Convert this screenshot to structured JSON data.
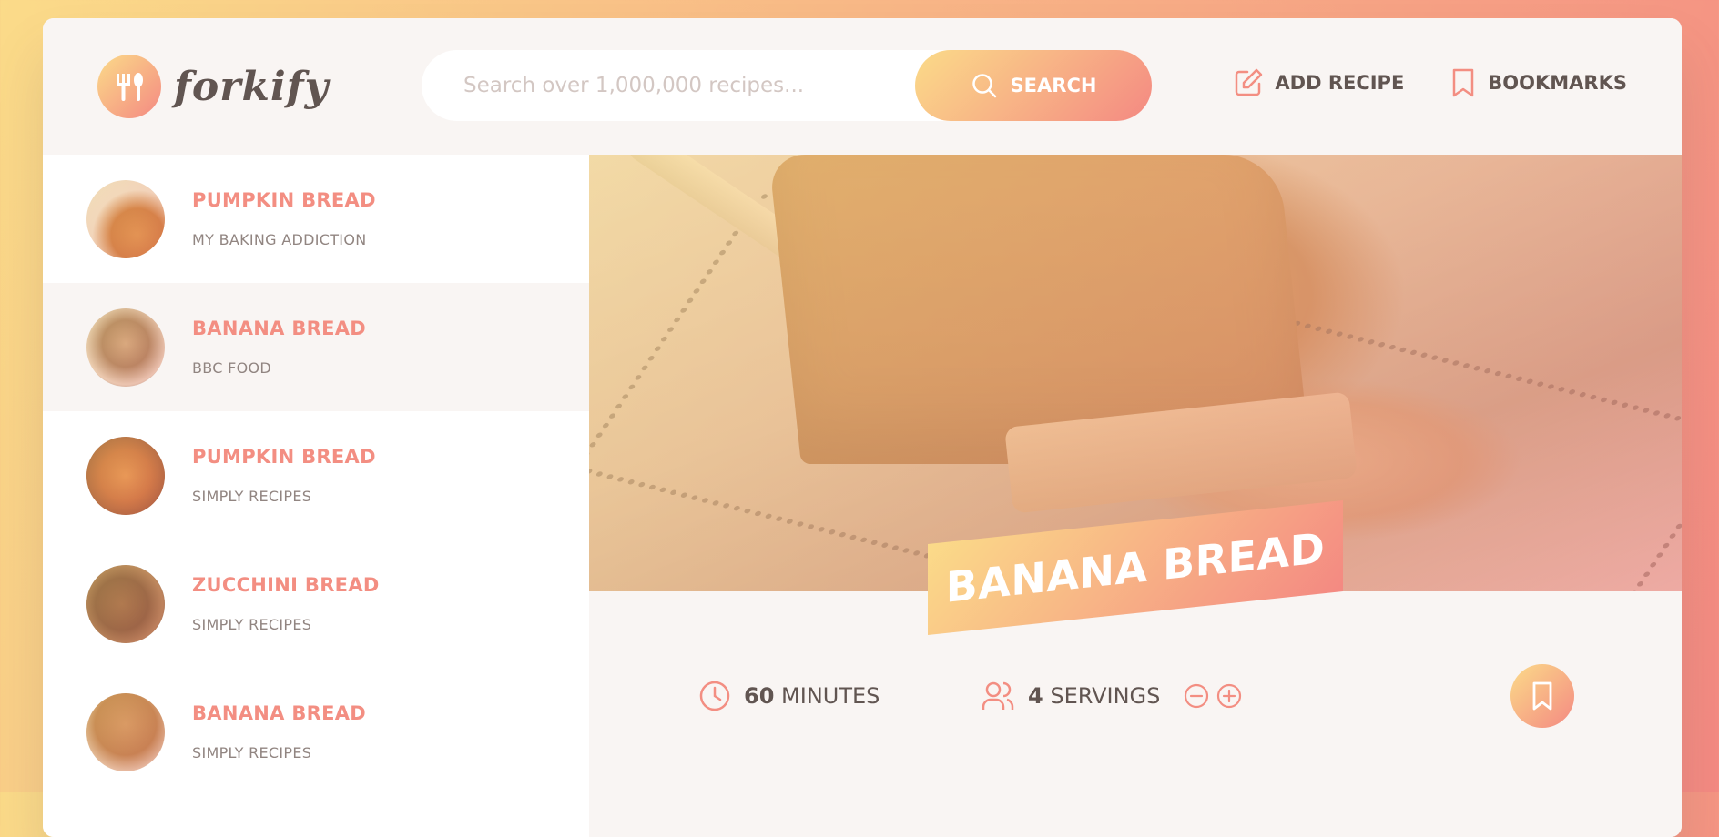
{
  "brand": {
    "name": "forkify"
  },
  "search": {
    "placeholder": "Search over 1,000,000 recipes...",
    "button_label": "SEARCH"
  },
  "nav": {
    "add_recipe": "ADD RECIPE",
    "bookmarks": "BOOKMARKS"
  },
  "results": [
    {
      "title": "PUMPKIN BREAD",
      "publisher": "MY BAKING ADDICTION",
      "active": false
    },
    {
      "title": "BANANA BREAD",
      "publisher": "BBC FOOD",
      "active": true
    },
    {
      "title": "PUMPKIN BREAD",
      "publisher": "SIMPLY RECIPES",
      "active": false
    },
    {
      "title": "ZUCCHINI BREAD",
      "publisher": "SIMPLY RECIPES",
      "active": false
    },
    {
      "title": "BANANA BREAD",
      "publisher": "SIMPLY RECIPES",
      "active": false
    }
  ],
  "recipe": {
    "title": "BANANA BREAD",
    "minutes": "60",
    "minutes_label": "MINUTES",
    "servings": "4",
    "servings_label": "SERVINGS"
  },
  "colors": {
    "accent_start": "#fbdb89",
    "accent_end": "#f48982",
    "text": "#615551"
  },
  "icons": {
    "logo": "fork-spoon-icon",
    "search": "search-icon",
    "add_recipe": "edit-icon",
    "bookmarks": "bookmark-icon",
    "clock": "clock-icon",
    "users": "users-icon",
    "minus": "minus-circle-icon",
    "plus": "plus-circle-icon"
  }
}
